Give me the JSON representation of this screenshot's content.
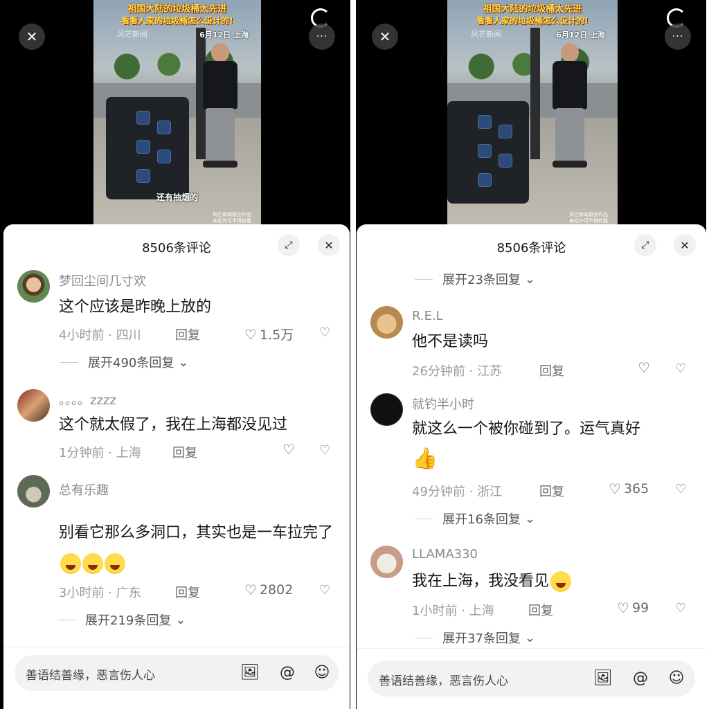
{
  "video": {
    "title_line1": "祖国大陆的垃圾桶太先进",
    "title_line2": "看看人家的垃圾桶怎么设计的!",
    "brand": "风芒新闻",
    "date": "6月12日 上海",
    "caption": "还有抽烟的",
    "watermark_line1": "风芒新闻原创作品",
    "watermark_line2": "未经许可不得转载"
  },
  "left": {
    "comment_count": "8506条评论",
    "comments": [
      {
        "user": "梦回尘间几寸欢",
        "text": "这个应该是昨晚上放的",
        "time": "4小时前 · 四川",
        "reply": "回复",
        "likes": "1.5万",
        "expand": "展开490条回复"
      },
      {
        "user": "。。。。zzzz",
        "text": "这个就太假了，我在上海都没见过",
        "time": "1分钟前 · 上海",
        "reply": "回复",
        "likes": ""
      },
      {
        "user": "总有乐趣",
        "text": "别看它那么多洞口，其实也是一车拉完了",
        "time": "3小时前 · 广东",
        "reply": "回复",
        "likes": "2802",
        "expand": "展开219条回复"
      }
    ],
    "input_placeholder": "善语结善缘，恶言伤人心"
  },
  "right": {
    "comment_count": "8506条评论",
    "top_expand": "展开23条回复",
    "comments": [
      {
        "user": "R.E.L",
        "text": "他不是读吗",
        "time": "26分钟前 · 江苏",
        "reply": "回复",
        "likes": ""
      },
      {
        "user": "就钓半小时",
        "text": "就这么一个被你碰到了。运气真好",
        "time": "49分钟前 · 浙江",
        "reply": "回复",
        "likes": "365",
        "expand": "展开16条回复"
      },
      {
        "user": "LLAMA330",
        "text": "我在上海，我没看见",
        "time": "1小时前 · 上海",
        "reply": "回复",
        "likes": "99",
        "expand": "展开37条回复"
      }
    ],
    "input_placeholder": "善语结善缘，恶言伤人心"
  },
  "icons": {
    "close": "close-icon",
    "more": "more-icon",
    "expand_sheet": "expand-icon",
    "heart": "heart-icon",
    "dislike": "dislike-icon",
    "image": "image-icon",
    "mention": "at-icon",
    "emoji": "emoji-icon"
  }
}
